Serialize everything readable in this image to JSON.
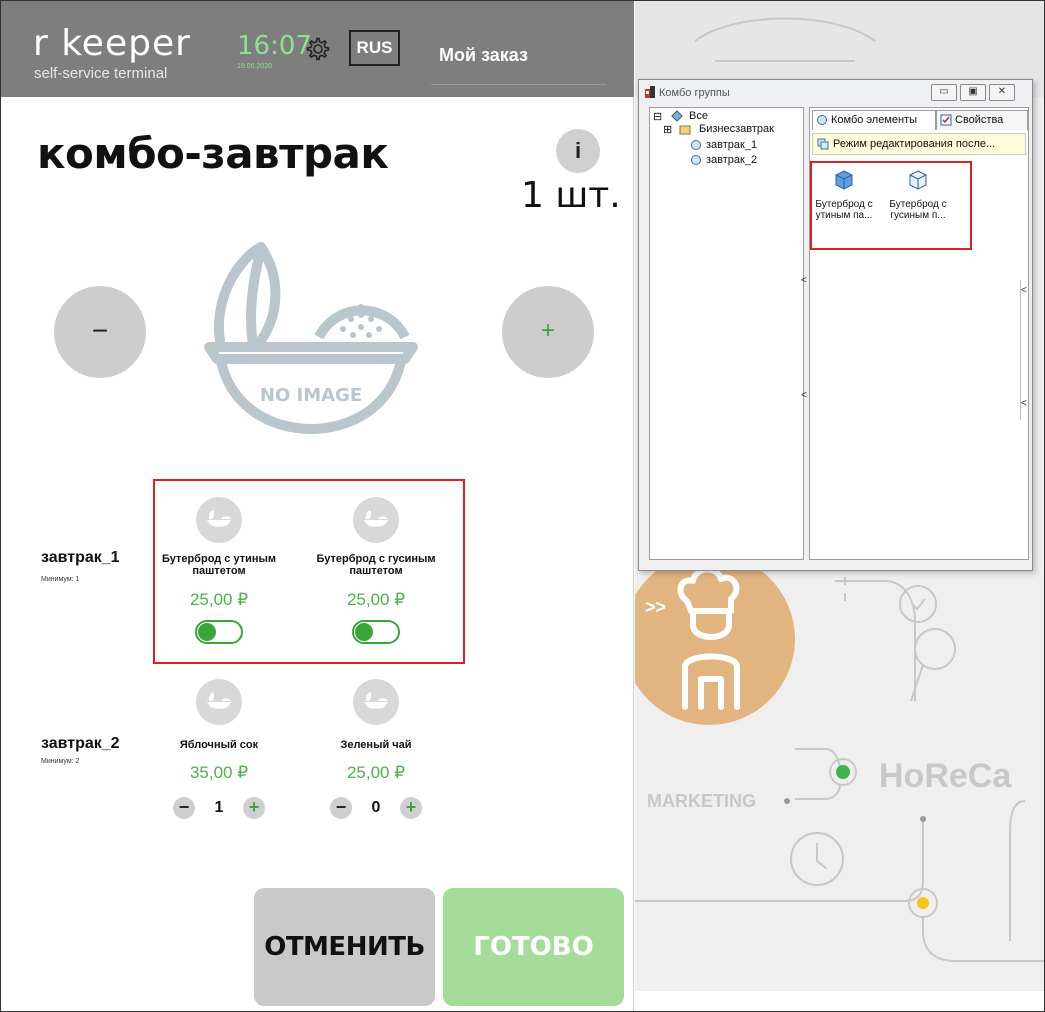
{
  "kiosk": {
    "brand": "r  keeper",
    "brand_sub": "self-service terminal",
    "time": "16:07",
    "date": "19.06.2020",
    "language": "RUS",
    "order_title": "Мой заказ",
    "product_title": "комбо-завтрак",
    "info_label": "i",
    "quantity": "1 шт.",
    "minus_label": "−",
    "plus_label": "+",
    "no_image_label": "NO IMAGE",
    "groups": [
      {
        "name": "завтрак_1",
        "minimum": "Минимум: 1",
        "items": [
          {
            "name": "Бутерброд с утиным паштетом",
            "price": "25,00 ₽",
            "selected": true
          },
          {
            "name": "Бутерброд с гусиным паштетом",
            "price": "25,00 ₽",
            "selected": true
          }
        ]
      },
      {
        "name": "завтрак_2",
        "minimum": "Минимум: 2",
        "items": [
          {
            "name": "Яблочный сок",
            "price": "35,00 ₽",
            "count": "1"
          },
          {
            "name": "Зеленый чай",
            "price": "25,00 ₽",
            "count": "0"
          }
        ]
      }
    ],
    "stepper_minus": "−",
    "stepper_plus": "+",
    "cancel_label": "ОТМЕНИТЬ",
    "done_label": "ГОТОВО",
    "colors": {
      "accent_green": "#3aa63a",
      "price_green": "#4fb04f",
      "done_bg": "#a6dc9a",
      "highlight_red": "#e02020"
    }
  },
  "background": {
    "horeca": "HoReCa",
    "marketing": "MARKETING",
    "chef_arrows": ">>"
  },
  "dialog": {
    "title": "Комбо группы",
    "window_buttons": [
      "▭",
      "▣",
      "✕"
    ],
    "tree": [
      {
        "label": "Все",
        "expander": "⊟"
      },
      {
        "label": "Бизнесзавтрак",
        "expander": "⊞"
      },
      {
        "label": "завтрак_1"
      },
      {
        "label": "завтрак_2"
      }
    ],
    "tabs": [
      {
        "label": "Комбо элементы",
        "icon": "combo-elements-icon"
      },
      {
        "label": "Свойства",
        "icon": "properties-icon"
      }
    ],
    "edit_mode": "Режим редактирования после...",
    "elements": [
      {
        "line1": "Бутерброд с",
        "line2": "утиным па..."
      },
      {
        "line1": "Бутерброд с",
        "line2": "гусиным п..."
      }
    ],
    "splitter_glyph": "<"
  }
}
